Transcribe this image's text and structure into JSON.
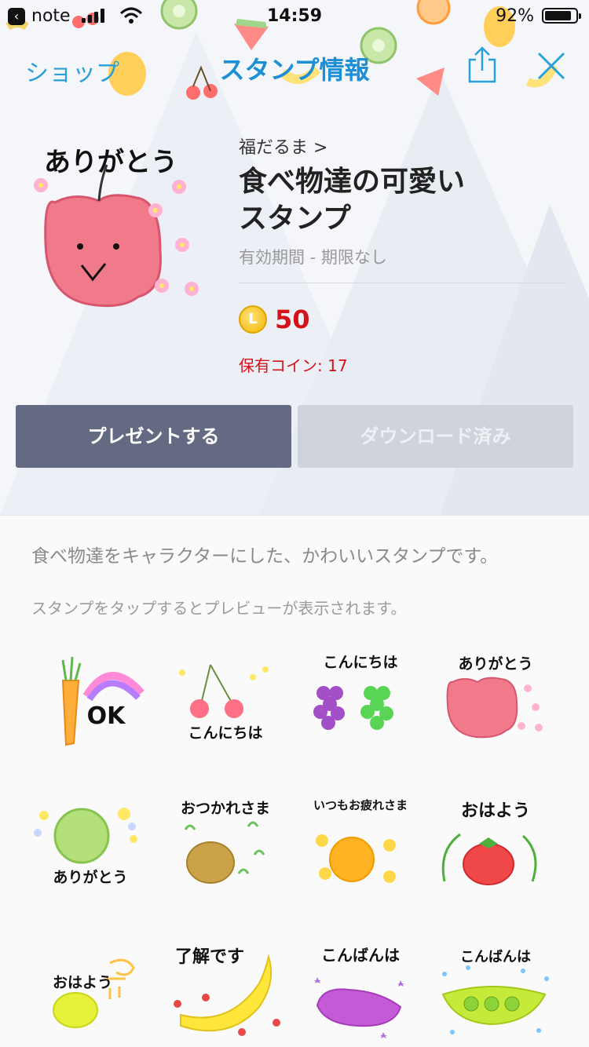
{
  "status_bar": {
    "back_app": "note",
    "time": "14:59",
    "battery": "92%",
    "battery_level": 0.92
  },
  "nav": {
    "shop_label": "ショップ",
    "title": "スタンプ情報"
  },
  "product": {
    "author": "福だるま >",
    "name_line1": "食べ物達の可愛い",
    "name_line2": "スタンプ",
    "validity": "有効期間 - 期限なし",
    "coin_mark": "L",
    "price": "50",
    "owned_coins": "保有コイン: 17",
    "main_caption": "ありがとう"
  },
  "buttons": {
    "gift": "プレゼントする",
    "download": "ダウンロード済み"
  },
  "description": "食べ物達をキャラクターにした、かわいいスタンプです。",
  "preview_hint": "スタンプをタップするとプレビューが表示されます。",
  "stickers": [
    {
      "caption": "OK",
      "icon": "carrot-rainbow"
    },
    {
      "caption": "こんにちは",
      "icon": "cherries"
    },
    {
      "caption": "こんにちは",
      "icon": "grapes"
    },
    {
      "caption": "ありがとう",
      "icon": "apple"
    },
    {
      "caption": "ありがとう",
      "icon": "melon"
    },
    {
      "caption": "おつかれさま",
      "icon": "potato"
    },
    {
      "caption": "いつもお疲れさま",
      "icon": "mandarin"
    },
    {
      "caption": "おはよう",
      "icon": "tomato"
    },
    {
      "caption": "おはよう",
      "icon": "lemon"
    },
    {
      "caption": "了解です",
      "icon": "banana"
    },
    {
      "caption": "こんばんは",
      "icon": "eggplant"
    },
    {
      "caption": "こんばんは",
      "icon": "peas"
    }
  ],
  "colors": {
    "accent": "#1c8fd6",
    "price_red": "#d5121a",
    "gift_button": "#646a82",
    "download_button": "#cfd3dc"
  }
}
